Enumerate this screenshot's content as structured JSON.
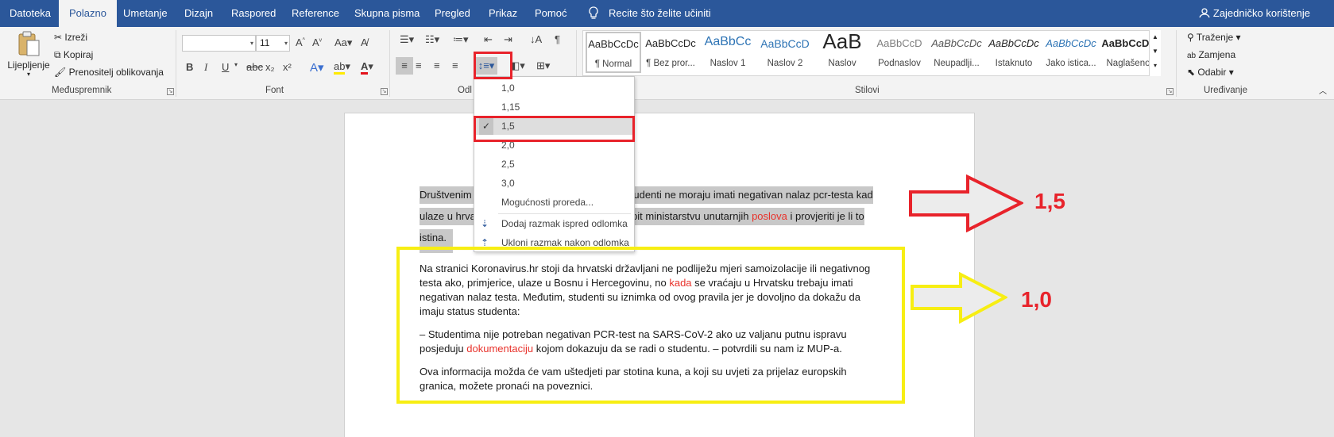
{
  "tabs": [
    "Datoteka",
    "Polazno",
    "Umetanje",
    "Dizajn",
    "Raspored",
    "Reference",
    "Skupna pisma",
    "Pregled",
    "Prikaz",
    "Pomoć"
  ],
  "active_tab": "Polazno",
  "tell_me": "Recite što želite učiniti",
  "share": "Zajedničko korištenje",
  "clipboard": {
    "paste": "Lijepljenje",
    "cut": "Izreži",
    "copy": "Kopiraj",
    "format_painter": "Prenositelj oblikovanja",
    "group": "Međuspremnik"
  },
  "font": {
    "name": "",
    "size": "11",
    "group": "Font",
    "bold": "B",
    "italic": "I",
    "underline": "U",
    "sub": "x₂",
    "sup": "x²"
  },
  "paragraph": {
    "group": "Odl"
  },
  "styles": {
    "group": "Stilovi",
    "items": [
      {
        "preview": "AaBbCcDc",
        "name": "¶ Normal"
      },
      {
        "preview": "AaBbCcDc",
        "name": "¶ Bez pror..."
      },
      {
        "preview": "AaBbCc",
        "name": "Naslov 1"
      },
      {
        "preview": "AaBbCcD",
        "name": "Naslov 2"
      },
      {
        "preview": "AaB",
        "name": "Naslov"
      },
      {
        "preview": "AaBbCcD",
        "name": "Podnaslov"
      },
      {
        "preview": "AaBbCcDc",
        "name": "Neupadlji..."
      },
      {
        "preview": "AaBbCcDc",
        "name": "Istaknuto"
      },
      {
        "preview": "AaBbCcDc",
        "name": "Jako istica..."
      },
      {
        "preview": "AaBbCcDc",
        "name": "Naglašeno"
      }
    ]
  },
  "editing": {
    "find": "Traženje",
    "replace": "Zamjena",
    "select": "Odabir",
    "group": "Uređivanje"
  },
  "spacing_menu": {
    "options": [
      "1,0",
      "1,15",
      "1,5",
      "2,0",
      "2,5",
      "3,0"
    ],
    "selected": "1,5",
    "more": "Mogućnosti proreda...",
    "add_before": "Dodaj razmak ispred odlomka",
    "remove_after": "Ukloni razmak nakon odlomka"
  },
  "document": {
    "p1_line1_a": "Društvenim",
    "p1_line1_b": "tudenti ne moraju imati negativan nalaz pcr-testa kad",
    "p1_line2_a": "ulaze u hrva",
    "p1_line2_b": "upit ministarstvu unutarnjih ",
    "p1_line2_red": "poslova",
    "p1_line2_c": " i provjeriti je li to",
    "p1_line3": "istina.",
    "p2_line1_a": "Na ",
    "p2_line1_b": "stranici",
    "p2_line1_c": " Koronavirus.hr stoji da hrvatski državljani ne podliježu mjeri samoizolacije ili negativnog",
    "p2_line2_a": "testa ako, primjerice, ulaze u Bosnu i Hercegovinu, no ",
    "p2_line2_red": "kada",
    "p2_line2_b": " se vraćaju u Hrvatsku trebaju imati",
    "p2_line3": "negativan nalaz testa. Međutim, studenti su iznimka od ovog pravila jer je dovoljno da dokažu da",
    "p2_line4": "imaju status studenta:",
    "p3_line1": "– Studentima nije potreban negativan PCR-test na SARS-CoV-2 ako uz valjanu putnu ispravu",
    "p3_line2_a": "posjeduju ",
    "p3_line2_red": "dokumentaciju",
    "p3_line2_b": " kojom dokazuju da se radi o studentu. – potvrdili su nam iz MUP-a.",
    "p4_line1": "Ova informacija možda će vam uštedjeti par stotina kuna, a koji su uvjeti za prijelaz europskih",
    "p4_line2": "granica, možete pronaći na poveznici."
  },
  "annotations": {
    "red_label": "1,5",
    "yellow_label": "1,0",
    "red_color": "#e8232b",
    "yellow_color": "#f7ee13"
  },
  "colors": {
    "titlebar": "#2b579a",
    "ribbon": "#f3f3f3",
    "canvas": "#e6e6e6"
  }
}
